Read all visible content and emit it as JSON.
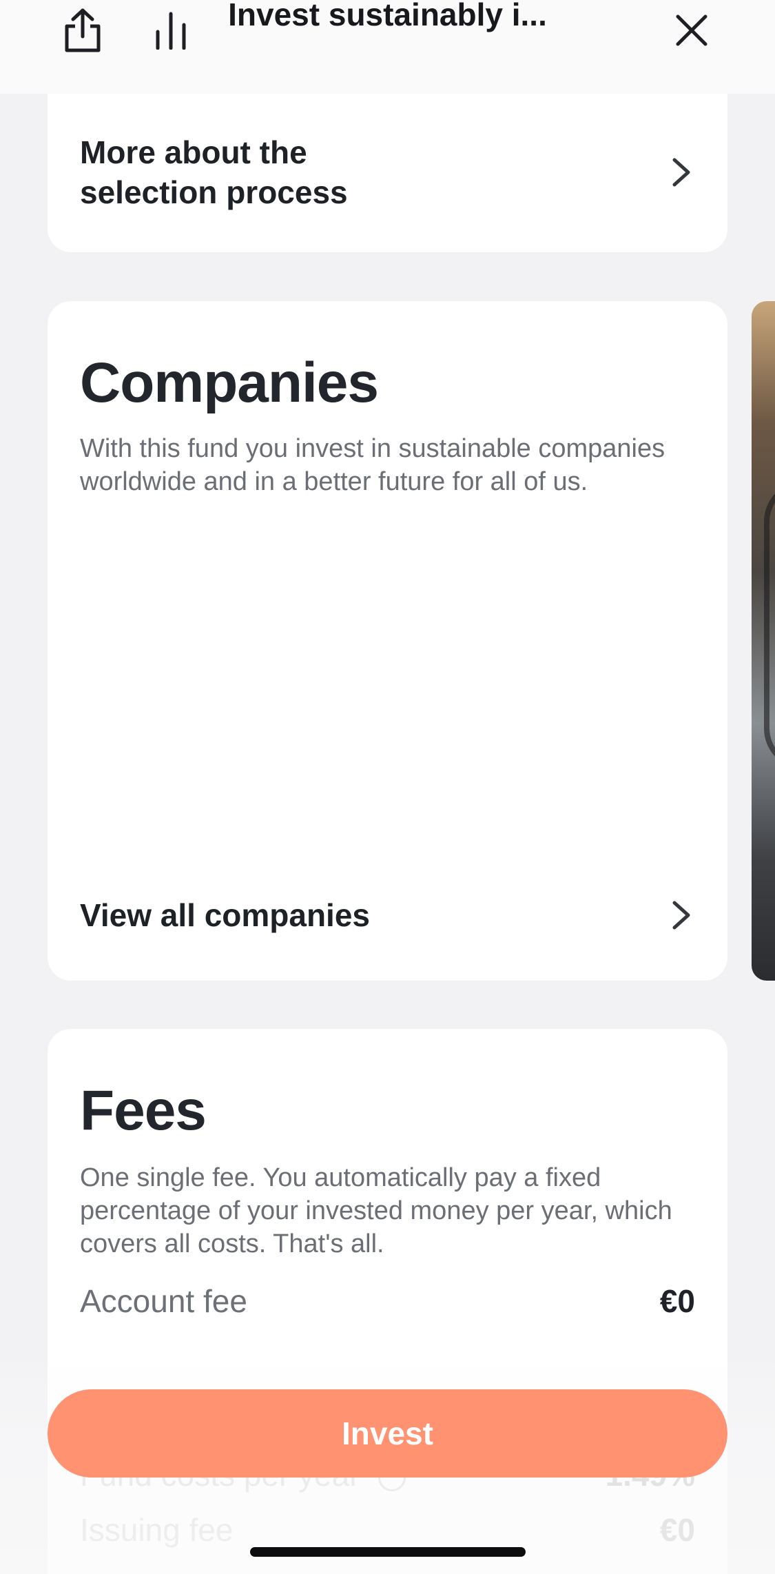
{
  "header": {
    "title": "Invest sustainably i...",
    "icons": [
      "share-icon",
      "bar-chart-icon",
      "close-icon"
    ]
  },
  "selection_card": {
    "link_label": "More about the selection process"
  },
  "companies_card": {
    "title": "Companies",
    "description": "With this fund you invest in sustainable companies worldwide and in a better future for all of us.",
    "link_label": "View all companies"
  },
  "fees_card": {
    "title": "Fees",
    "description": "One single fee. You automatically pay a fixed percentage of your invested money per year, which covers all costs. That's all.",
    "rows": [
      {
        "label": "Account fee",
        "value": "€0"
      },
      {
        "label": "Fund costs per year",
        "value": "1.49%"
      },
      {
        "label": "Issuing fee",
        "value": "€0"
      }
    ]
  },
  "cta": {
    "invest_label": "Invest"
  },
  "colors": {
    "accent": "#ff9270",
    "background": "#f2f2f4",
    "card": "#ffffff",
    "text_primary": "#22252b",
    "text_secondary": "#6b6e74"
  }
}
